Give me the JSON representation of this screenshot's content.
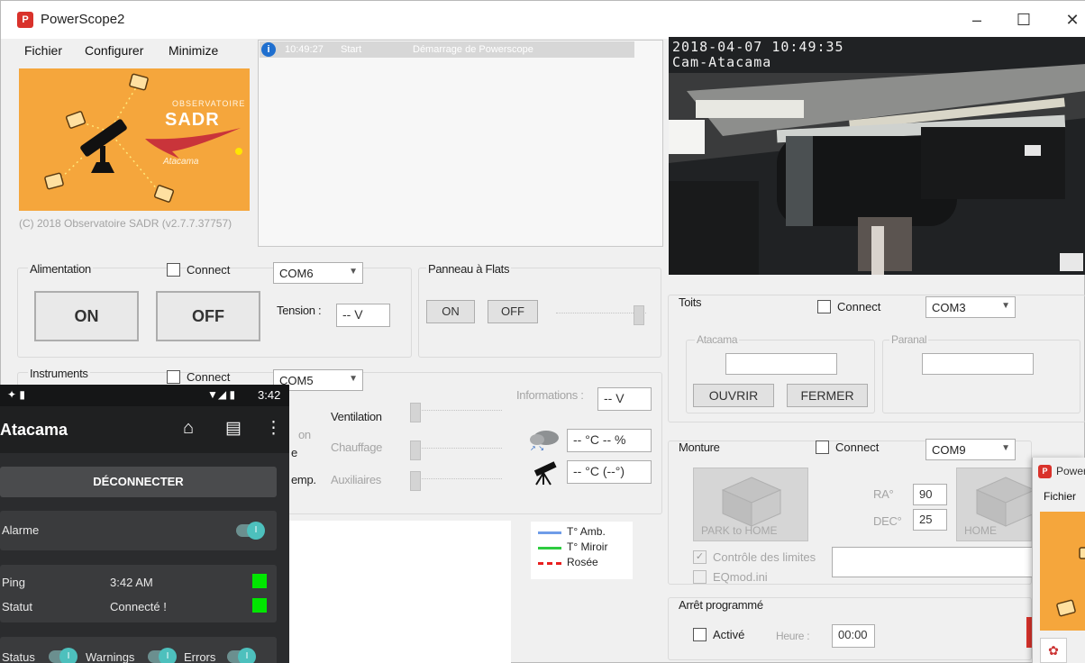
{
  "window": {
    "title": "PowerScope2",
    "minimize_glyph": "–",
    "maximize_glyph": "☐",
    "close_glyph": "✕",
    "app_icon_glyph": "P"
  },
  "menu": [
    "Fichier",
    "Configurer",
    "Minimize"
  ],
  "logo": {
    "line1": "OBSERVATOIRE",
    "line2": "SADR",
    "line3": "Atacama"
  },
  "copyright": "(C) 2018 Observatoire SADR  (v2.7.7.37757)",
  "log": {
    "rows": [
      {
        "time": "10:49:27",
        "type": "Start",
        "message": "Démarrage de Powerscope"
      }
    ]
  },
  "camera": {
    "timestamp": "2018-04-07 10:49:35",
    "name": "Cam-Atacama"
  },
  "alimentation": {
    "label": "Alimentation",
    "connect_label": "Connect",
    "port": "COM6",
    "on_label": "ON",
    "off_label": "OFF",
    "tension_label": "Tension :",
    "tension_value": "-- V"
  },
  "panneau": {
    "label": "Panneau à Flats",
    "on_label": "ON",
    "off_label": "OFF",
    "level": 1.0
  },
  "instruments": {
    "label": "Instruments",
    "connect_label": "Connect",
    "port": "COM5",
    "informations_label": "Informations :",
    "voltage_value": "-- V",
    "sliders": [
      {
        "left_label": "on",
        "label": "Ventilation",
        "level": 0.0
      },
      {
        "left_label": "e",
        "label": "Chauffage",
        "level": 0.0
      },
      {
        "left_label": "emp.",
        "label": "Auxiliaires",
        "level": 0.0
      }
    ],
    "weather_value": "-- °C -- %",
    "telescope_value": "-- °C (--°)",
    "legend": [
      {
        "label": "T° Amb.",
        "color": "#6f9ce8"
      },
      {
        "label": "T° Miroir",
        "color": "#2ecc40"
      },
      {
        "label": "Rosée",
        "color": "#e81f1f"
      }
    ]
  },
  "toits": {
    "label": "Toits",
    "connect_label": "Connect",
    "port": "COM3",
    "atacama_label": "Atacama",
    "paranal_label": "Paranal",
    "ouvrir_label": "OUVRIR",
    "fermer_label": "FERMER"
  },
  "monture": {
    "label": "Monture",
    "connect_label": "Connect",
    "port": "COM9",
    "park_label": "PARK",
    "home_label": "HOME",
    "park_home_label": "PARK to HOME",
    "ra_label": "RA°",
    "ra_value": "90",
    "dec_label": "DEC°",
    "dec_value": "25",
    "limits_label": "Contrôle des limites",
    "eqmod_label": "EQmod.ini"
  },
  "arret": {
    "label": "Arrêt programmé",
    "active_label": "Activé",
    "heure_label": "Heure :",
    "heure_value": "00:00"
  },
  "phone": {
    "time": "3:42",
    "title": "Atacama",
    "disconnect_label": "DÉCONNECTER",
    "alarme_label": "Alarme",
    "ping_label": "Ping",
    "ping_value": "3:42 AM",
    "statut_label": "Statut",
    "statut_value": "Connecté !",
    "bottom": [
      {
        "label": "Status"
      },
      {
        "label": "Warnings"
      },
      {
        "label": "Errors"
      }
    ]
  },
  "mini_window": {
    "title": "PowerS",
    "menu_item": "Fichier"
  }
}
